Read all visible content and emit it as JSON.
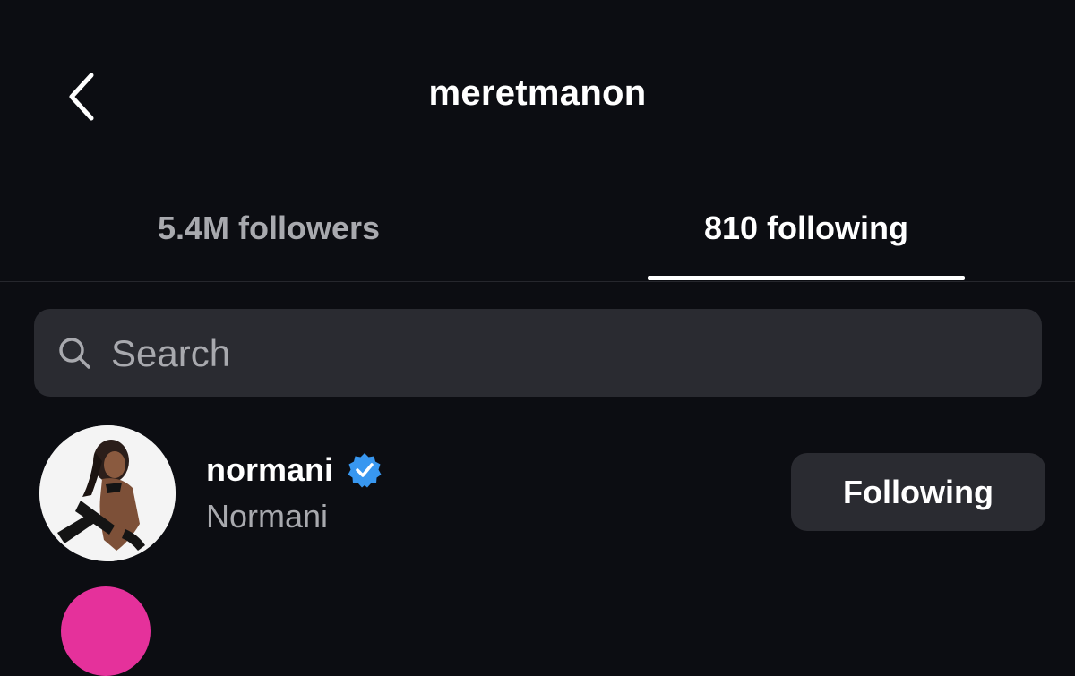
{
  "header": {
    "title": "meretmanon",
    "back_icon": "chevron-left-icon"
  },
  "tabs": [
    {
      "label": "5.4M followers",
      "active": false
    },
    {
      "label": "810 following",
      "active": true
    }
  ],
  "search": {
    "placeholder": "Search",
    "value": "",
    "icon": "search-icon"
  },
  "list": [
    {
      "username": "normani",
      "verified": true,
      "full_name": "Normani",
      "button_label": "Following"
    }
  ],
  "colors": {
    "background": "#0c0d12",
    "surface": "#2a2b31",
    "text_primary": "#ffffff",
    "text_secondary": "#a8a9ae",
    "verified_badge": "#3897f0",
    "next_avatar_ring": "#e5319b"
  }
}
